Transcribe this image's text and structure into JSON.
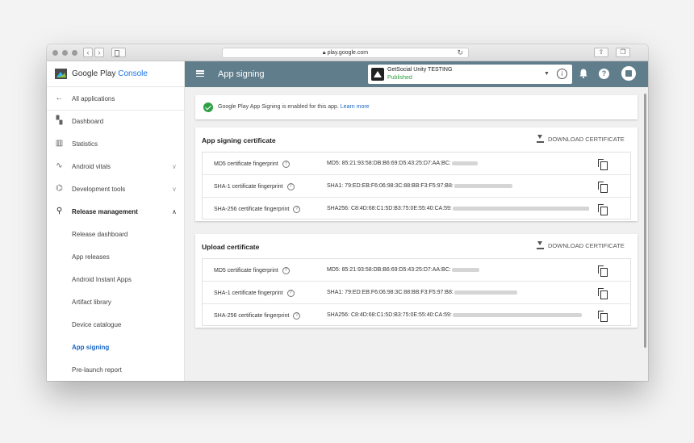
{
  "browser": {
    "url": "play.google.com"
  },
  "sidebar": {
    "brand": "Google Play",
    "brand_accent": "Console",
    "items": [
      {
        "label": "All applications",
        "icon": "arrow-left-icon"
      },
      {
        "label": "Dashboard",
        "icon": "dashboard-icon"
      },
      {
        "label": "Statistics",
        "icon": "bar-chart-icon"
      },
      {
        "label": "Android vitals",
        "icon": "pulse-icon"
      },
      {
        "label": "Development tools",
        "icon": "code-icon"
      },
      {
        "label": "Release management",
        "icon": "rocket-icon"
      }
    ],
    "sub_items": [
      {
        "label": "Release dashboard"
      },
      {
        "label": "App releases"
      },
      {
        "label": "Android Instant Apps"
      },
      {
        "label": "Artifact library"
      },
      {
        "label": "Device catalogue"
      },
      {
        "label": "App signing"
      },
      {
        "label": "Pre-launch report"
      }
    ]
  },
  "appbar": {
    "title": "App signing",
    "app_name": "GetSocial Unity TESTING",
    "app_status": "Published"
  },
  "notice": {
    "text": "Google Play App Signing is enabled for this app.",
    "link": "Learn more"
  },
  "app_signing_cert": {
    "title": "App signing certificate",
    "download": "DOWNLOAD CERTIFICATE",
    "rows": [
      {
        "label": "MD5 certificate fingerprint",
        "value": "MD5: 85:21:93:58:DB:B6:69:D5:43:25:D7:AA:BC:"
      },
      {
        "label": "SHA-1 certificate fingerprint",
        "value": "SHA1: 79:ED:EB:F6:06:98:3C:88:BB:F3:F5:97:B8:"
      },
      {
        "label": "SHA-256 certificate fingerprint",
        "value": "SHA256: C8:4D:68:C1:5D:B3:75:0E:55:40:CA:59:"
      }
    ]
  },
  "upload_cert": {
    "title": "Upload certificate",
    "download": "DOWNLOAD CERTIFICATE",
    "rows": [
      {
        "label": "MD5 certificate fingerprint",
        "value": "MD5: 85:21:93:58:DB:B6:69:D5:43:25:D7:AA:BC:"
      },
      {
        "label": "SHA-1 certificate fingerprint",
        "value": "SHA1: 79:ED:EB:F6:06:98:3C:88:BB:F3:F5:97:B8:"
      },
      {
        "label": "SHA-256 certificate fingerprint",
        "value": "SHA256: C8:4D:68:C1:5D:B3:75:0E:55:40:CA:59:"
      }
    ]
  },
  "colors": {
    "appbar": "#607d8b",
    "link": "#1a66c4",
    "success": "#2ea043"
  }
}
